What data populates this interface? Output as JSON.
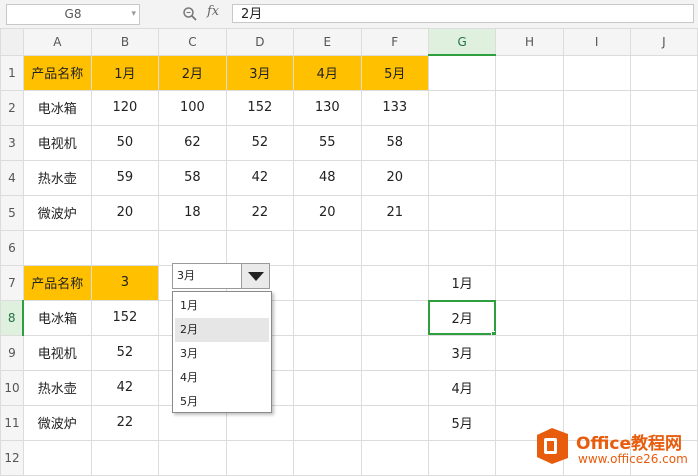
{
  "formula_bar": {
    "name_box": "G8",
    "fx_label": "fx",
    "formula": "2月"
  },
  "columns": [
    "A",
    "B",
    "C",
    "D",
    "E",
    "F",
    "G",
    "H",
    "I",
    "J"
  ],
  "rows": [
    {
      "num": "1",
      "cells": [
        "产品名称",
        "1月",
        "2月",
        "3月",
        "4月",
        "5月",
        "",
        "",
        "",
        ""
      ]
    },
    {
      "num": "2",
      "cells": [
        "电冰箱",
        "120",
        "100",
        "152",
        "130",
        "133",
        "",
        "",
        "",
        ""
      ]
    },
    {
      "num": "3",
      "cells": [
        "电视机",
        "50",
        "62",
        "52",
        "55",
        "58",
        "",
        "",
        "",
        ""
      ]
    },
    {
      "num": "4",
      "cells": [
        "热水壶",
        "59",
        "58",
        "42",
        "48",
        "20",
        "",
        "",
        "",
        ""
      ]
    },
    {
      "num": "5",
      "cells": [
        "微波炉",
        "20",
        "18",
        "22",
        "20",
        "21",
        "",
        "",
        "",
        ""
      ]
    },
    {
      "num": "6",
      "cells": [
        "",
        "",
        "",
        "",
        "",
        "",
        "",
        "",
        "",
        ""
      ]
    },
    {
      "num": "7",
      "cells": [
        "产品名称",
        "3",
        "",
        "",
        "",
        "",
        "1月",
        "",
        "",
        ""
      ]
    },
    {
      "num": "8",
      "cells": [
        "电冰箱",
        "152",
        "",
        "",
        "",
        "",
        "2月",
        "",
        "",
        ""
      ]
    },
    {
      "num": "9",
      "cells": [
        "电视机",
        "52",
        "",
        "",
        "",
        "",
        "3月",
        "",
        "",
        ""
      ]
    },
    {
      "num": "10",
      "cells": [
        "热水壶",
        "42",
        "",
        "",
        "",
        "",
        "4月",
        "",
        "",
        ""
      ]
    },
    {
      "num": "11",
      "cells": [
        "微波炉",
        "22",
        "",
        "",
        "",
        "",
        "5月",
        "",
        "",
        ""
      ]
    },
    {
      "num": "12",
      "cells": [
        "",
        "",
        "",
        "",
        "",
        "",
        "",
        "",
        "",
        ""
      ]
    }
  ],
  "active_cell": "G8",
  "dropdown": {
    "selected": "3月",
    "options": [
      "1月",
      "2月",
      "3月",
      "4月",
      "5月"
    ],
    "highlighted": "2月"
  },
  "watermark": {
    "title": "Office教程网",
    "url": "www.office26.com"
  },
  "colors": {
    "header_fill": "#ffc000",
    "selection": "#2e9e3e",
    "watermark": "#e85c0d"
  }
}
